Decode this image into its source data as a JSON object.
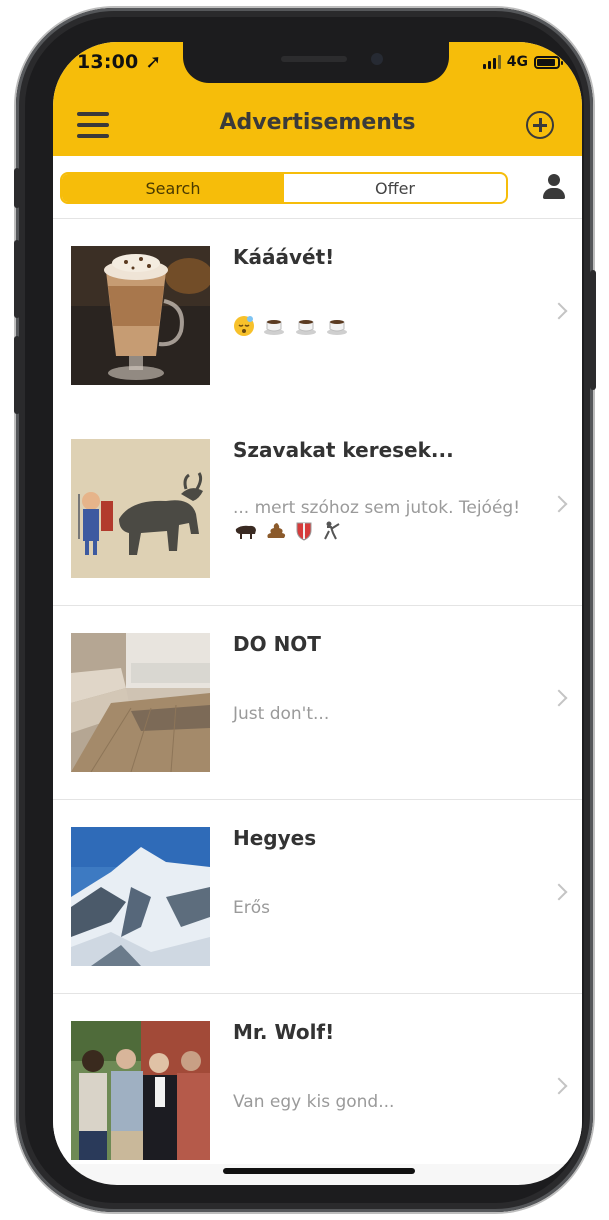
{
  "status": {
    "time": "13:00",
    "network": "4G"
  },
  "header": {
    "title": "Advertisements"
  },
  "segments": {
    "search": "Search",
    "offer": "Offer",
    "selected": "Search"
  },
  "colors": {
    "accent": "#f6bd0a",
    "text_dark": "#333333",
    "text_muted": "#9a9a9a"
  },
  "ads": [
    {
      "title": "Kááávét!",
      "description": "",
      "emoji": [
        "sleepy-face",
        "coffee",
        "coffee",
        "coffee"
      ]
    },
    {
      "title": "Szavakat keresek...",
      "description": "... mert szóhoz sem jutok. Tejóég!",
      "emoji": [
        "ox",
        "poop",
        "shield",
        "fencer"
      ]
    },
    {
      "title": "DO NOT",
      "description": "Just don't..."
    },
    {
      "title": "Hegyes",
      "description": "Erős"
    },
    {
      "title": "Mr. Wolf!",
      "description": "Van egy kis gond..."
    }
  ]
}
